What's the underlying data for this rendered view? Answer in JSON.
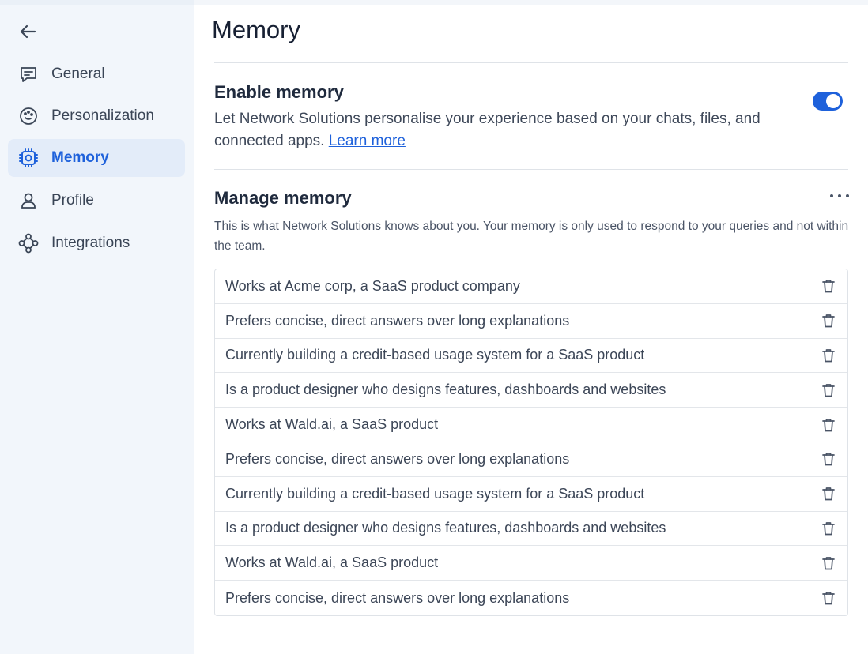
{
  "sidebar": {
    "back_icon": "arrow-left-icon",
    "items": [
      {
        "label": "General",
        "icon": "message-square-icon",
        "active": false
      },
      {
        "label": "Personalization",
        "icon": "palette-icon",
        "active": false
      },
      {
        "label": "Memory",
        "icon": "chip-icon",
        "active": true
      },
      {
        "label": "Profile",
        "icon": "user-icon",
        "active": false
      },
      {
        "label": "Integrations",
        "icon": "nodes-icon",
        "active": false
      }
    ]
  },
  "main": {
    "title": "Memory",
    "enable": {
      "title": "Enable memory",
      "description": "Let Network Solutions personalise your experience based on your chats, files, and connected apps.",
      "link_label": "Learn more",
      "enabled": true
    },
    "manage": {
      "title": "Manage memory",
      "description": "This is what Network Solutions knows about you. Your memory is only used to respond to your queries and not within the team.",
      "items": [
        "Works at Acme corp, a SaaS product company",
        "Prefers concise, direct answers over long explanations",
        "Currently building a credit-based usage system for a SaaS product",
        "Is a product designer who designs features, dashboards and websites",
        "Works at Wald.ai, a SaaS product",
        "Prefers concise, direct answers over long explanations",
        "Currently building a credit-based usage system for a SaaS product",
        "Is a product designer who designs features, dashboards and websites",
        "Works at Wald.ai, a SaaS product",
        "Prefers concise, direct answers over long explanations"
      ]
    }
  },
  "colors": {
    "accent": "#1e61db",
    "sidebar_bg": "#f2f6fb",
    "active_bg": "#e3ecf9"
  }
}
